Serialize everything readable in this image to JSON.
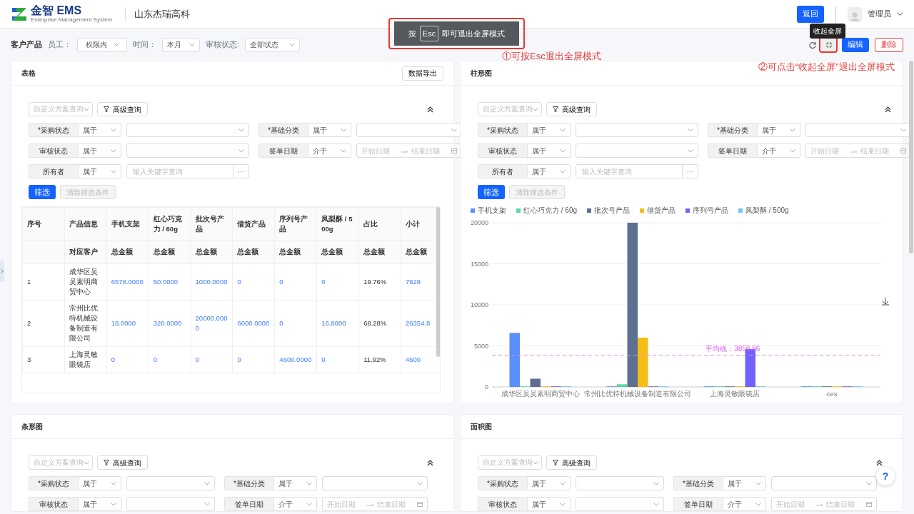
{
  "header": {
    "brand": "金智 EMS",
    "tagline": "Enterprise Management System",
    "company": "山东杰瑞高科",
    "back_button": "返回",
    "user": "管理员"
  },
  "toolbar": {
    "title": "客户产品",
    "filters": [
      {
        "label": "员工：",
        "value": "权限内"
      },
      {
        "label": "时间：",
        "value": "本月"
      },
      {
        "label": "审核状态:",
        "value": "全部状态"
      }
    ],
    "tooltip": "收起全屏",
    "edit_button": "编辑",
    "delete_button": "删除"
  },
  "esc_toast": {
    "prefix": "按",
    "key": "Esc",
    "suffix": "即可退出全屏模式"
  },
  "annotations": [
    "①可按Esc退出全屏模式",
    "②可点击“收起全屏”退出全屏模式"
  ],
  "panels": [
    {
      "title": "表格",
      "kind": "table",
      "export_button": "数据导出",
      "query": {
        "scheme_placeholder": "自定义方案查询",
        "advanced_button": "高级查询",
        "filter_button": "筛选",
        "clear_button": "清除筛选条件",
        "conditions": [
          {
            "kind": "select",
            "label": "*采购状态",
            "operator": "属于"
          },
          {
            "kind": "select",
            "label": "*基础分类",
            "operator": "属于"
          },
          {
            "kind": "select",
            "label": "审核状态",
            "operator": "属于"
          },
          {
            "kind": "date_range",
            "label": "签单日期",
            "operator": "介于",
            "start_placeholder": "开始日期",
            "end_placeholder": "结束日期"
          },
          {
            "kind": "keyword",
            "label": "所有者",
            "operator": "属于",
            "placeholder": "输入关键字查询",
            "more_label": "···"
          }
        ]
      },
      "table": {
        "columns": [
          {
            "label": "序号",
            "kind": "text"
          },
          {
            "label": "产品信息",
            "sublabel": "对应客户",
            "kind": "text"
          },
          {
            "label": "手机支架",
            "sublabel": "总金额",
            "kind": "link"
          },
          {
            "label": "红心巧克力 / 60g",
            "sublabel": "总金额",
            "kind": "link"
          },
          {
            "label": "批次号产品",
            "sublabel": "总金额",
            "kind": "link"
          },
          {
            "label": "借货产品",
            "sublabel": "总金额",
            "kind": "link"
          },
          {
            "label": "序列号产品",
            "sublabel": "总金额",
            "kind": "link"
          },
          {
            "label": "凤梨酥 / 500g",
            "sublabel": "总金额",
            "kind": "link"
          },
          {
            "label": "占比",
            "sublabel": "总金额",
            "kind": "text"
          },
          {
            "label": "小计",
            "sublabel": "总金额",
            "kind": "link"
          }
        ],
        "rows": [
          [
            "1",
            "成华区吴吴素明商贸中心",
            "6578.0000",
            "50.0000",
            "1000.0000",
            "0",
            "0",
            "0",
            "19.76%",
            "7628"
          ],
          [
            "2",
            "常州比优特机械设备制造有限公司",
            "18.0000",
            "320.0000",
            "20000.0000",
            "6000.0000",
            "0",
            "16.8000",
            "68.28%",
            "26354.8"
          ],
          [
            "3",
            "上海灵敏眼镜店",
            "0",
            "0",
            "0",
            "0",
            "4600.0000",
            "0",
            "11.92%",
            "4600"
          ]
        ]
      }
    },
    {
      "title": "柱形图",
      "kind": "bar_chart",
      "query": {
        "scheme_placeholder": "自定义方案查询",
        "advanced_button": "高级查询",
        "filter_button": "筛选",
        "clear_button": "清除筛选条件",
        "conditions": [
          {
            "kind": "select",
            "label": "*采购状态",
            "operator": "属于"
          },
          {
            "kind": "select",
            "label": "*基础分类",
            "operator": "属于"
          },
          {
            "kind": "select",
            "label": "审核状态",
            "operator": "属于"
          },
          {
            "kind": "date_range",
            "label": "签单日期",
            "operator": "介于",
            "start_placeholder": "开始日期",
            "end_placeholder": "结束日期"
          },
          {
            "kind": "keyword",
            "label": "所有者",
            "operator": "属于",
            "placeholder": "输入关键字查询",
            "more_label": "···"
          }
        ]
      },
      "chart_data": {
        "type": "bar",
        "categories": [
          "成华区吴吴素明商贸中心",
          "常州比优特机械设备制造有限公司",
          "上海灵敏眼镜店",
          "ces"
        ],
        "series": [
          {
            "name": "手机支架",
            "color": "#5b8ff9",
            "values": [
              6578,
              18,
              0,
              0
            ]
          },
          {
            "name": "红心巧克力 / 60g",
            "color": "#5ad8a6",
            "values": [
              50,
              320,
              0,
              0
            ]
          },
          {
            "name": "批次号产品",
            "color": "#5d7092",
            "values": [
              1000,
              20000,
              0,
              0
            ]
          },
          {
            "name": "借货产品",
            "color": "#f6bd16",
            "values": [
              0,
              6000,
              0,
              0
            ]
          },
          {
            "name": "序列号产品",
            "color": "#7262fd",
            "values": [
              0,
              0,
              4600,
              0
            ]
          },
          {
            "name": "凤梨酥 / 500g",
            "color": "#6dc8ec",
            "values": [
              0,
              16.8,
              0,
              0
            ]
          }
        ],
        "ylim": [
          0,
          20000
        ],
        "yticks": [
          0,
          5000,
          10000,
          15000,
          20000
        ],
        "grid": true,
        "ref_lines": [
          {
            "axis": "y",
            "value": 3859.96,
            "label": "平均线：3859.96"
          }
        ]
      }
    },
    {
      "title": "条形图",
      "kind": "bar",
      "query": {
        "scheme_placeholder": "自定义方案查询",
        "advanced_button": "高级查询",
        "conditions": [
          {
            "kind": "select",
            "label": "*采购状态",
            "operator": "属于"
          },
          {
            "kind": "select",
            "label": "*基础分类",
            "operator": "属于"
          },
          {
            "kind": "select",
            "label": "审核状态",
            "operator": "属于"
          },
          {
            "kind": "date_range",
            "label": "签单日期",
            "operator": "介于",
            "start_placeholder": "开始日期",
            "end_placeholder": "结束日期"
          }
        ]
      }
    },
    {
      "title": "面积图",
      "kind": "area",
      "query": {
        "scheme_placeholder": "自定义方案查询",
        "advanced_button": "高级查询",
        "conditions": [
          {
            "kind": "select",
            "label": "*采购状态",
            "operator": "属于"
          },
          {
            "kind": "select",
            "label": "*基础分类",
            "operator": "属于"
          },
          {
            "kind": "select",
            "label": "审核状态",
            "operator": "属于"
          },
          {
            "kind": "date_range",
            "label": "签单日期",
            "operator": "介于",
            "start_placeholder": "开始日期",
            "end_placeholder": "结束日期"
          }
        ]
      }
    }
  ],
  "help_button": "?"
}
